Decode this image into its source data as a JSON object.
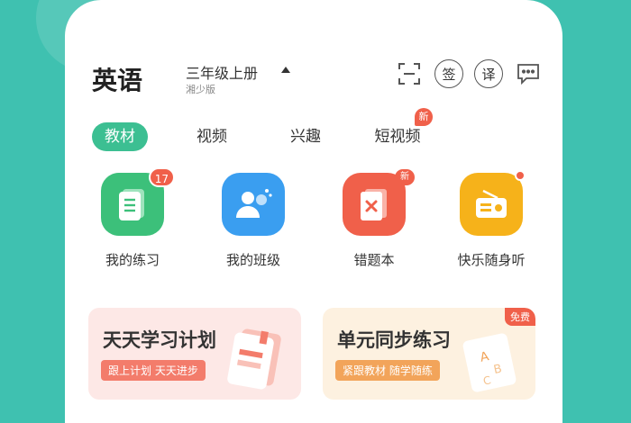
{
  "header": {
    "subject": "英语",
    "grade": "三年级上册",
    "edition": "湘少版",
    "icons": {
      "scan": "scan-icon",
      "sign": "签",
      "translate": "译",
      "message": "message-icon"
    }
  },
  "tabs": [
    {
      "label": "教材",
      "active": true
    },
    {
      "label": "视频",
      "active": false
    },
    {
      "label": "兴趣",
      "active": false
    },
    {
      "label": "短视频",
      "active": false,
      "badge": "新"
    }
  ],
  "apps": [
    {
      "label": "我的练习",
      "icon": "exercise-list-icon",
      "badge": "17",
      "color": "#3cc07a"
    },
    {
      "label": "我的班级",
      "icon": "class-users-icon",
      "color": "#3a9ef0"
    },
    {
      "label": "错题本",
      "icon": "wrong-questions-book-icon",
      "badge": "新",
      "color": "#f0604a"
    },
    {
      "label": "快乐随身听",
      "icon": "radio-icon",
      "dot": true,
      "color": "#f6b21a"
    }
  ],
  "cards": [
    {
      "title": "天天学习计划",
      "subtitle": "跟上计划 天天进步",
      "bg": "#fde8e6",
      "accent": "#f37c6b"
    },
    {
      "title": "单元同步练习",
      "subtitle": "紧跟教材 随学随练",
      "badge": "免费",
      "bg": "#fdf1e0",
      "accent": "#f2a45a"
    }
  ],
  "colors": {
    "brand_green": "#3cbf92",
    "background": "#3fc1b0",
    "badge_red": "#f0604a"
  }
}
